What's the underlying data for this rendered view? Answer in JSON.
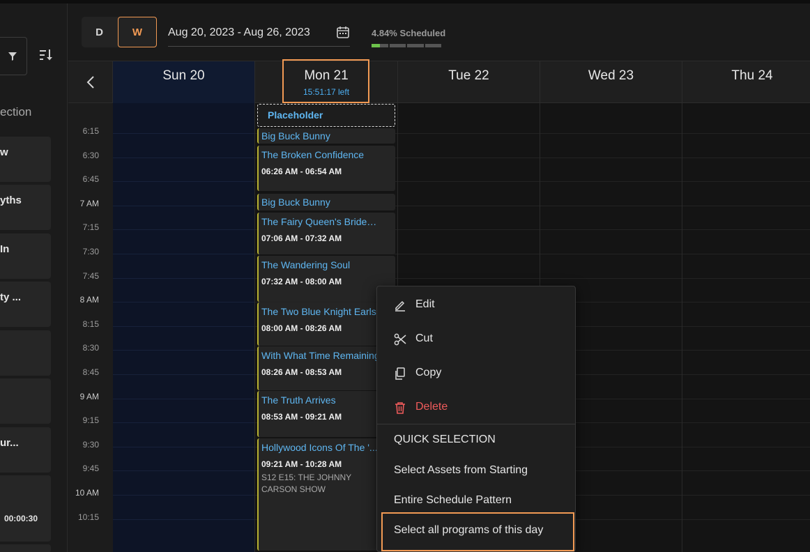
{
  "left_panel": {
    "section_label": "ection",
    "cards": [
      {
        "title": "w",
        "duration": ""
      },
      {
        "title": "yths",
        "duration": ""
      },
      {
        "title": "In",
        "duration": ""
      },
      {
        "title": "ty ...",
        "duration": ""
      },
      {
        "title": "",
        "duration": ""
      },
      {
        "title": "",
        "duration": ""
      },
      {
        "title": "ur...",
        "duration": ""
      },
      {
        "title": "",
        "duration": "00:00:30"
      }
    ]
  },
  "header": {
    "view_day": "D",
    "view_week": "W",
    "date_range": "Aug 20, 2023 - Aug 26, 2023",
    "scheduled_text": "4.84% Scheduled",
    "scheduled_fraction": 0.0484
  },
  "days": [
    {
      "label": "Sun 20",
      "remaining": ""
    },
    {
      "label": "Mon 21",
      "remaining": "15:51:17 left"
    },
    {
      "label": "Tue 22",
      "remaining": ""
    },
    {
      "label": "Wed 23",
      "remaining": ""
    },
    {
      "label": "Thu 24",
      "remaining": ""
    }
  ],
  "time_labels": [
    "6:15",
    "6:30",
    "6:45",
    "7 AM",
    "7:15",
    "7:30",
    "7:45",
    "8 AM",
    "8:15",
    "8:30",
    "8:45",
    "9 AM",
    "9:15",
    "9:30",
    "9:45",
    "10 AM",
    "10:15"
  ],
  "events": {
    "placeholder": "Placeholder",
    "items": [
      {
        "title": "Big Buck Bunny",
        "time": "",
        "subtitle": ""
      },
      {
        "title": "The Broken Confidence",
        "time": "06:26 AM - 06:54 AM",
        "subtitle": ""
      },
      {
        "title": "Big Buck Bunny",
        "time": "",
        "subtitle": ""
      },
      {
        "title": "The Fairy Queen's Bridegroom",
        "time": "07:06 AM - 07:32 AM",
        "subtitle": ""
      },
      {
        "title": "The Wandering Soul",
        "time": "07:32 AM - 08:00 AM",
        "subtitle": ""
      },
      {
        "title": "The Two Blue Knight Earls",
        "time": "08:00 AM - 08:26 AM",
        "subtitle": ""
      },
      {
        "title": "With What Time Remaining",
        "time": "08:26 AM - 08:53 AM",
        "subtitle": ""
      },
      {
        "title": "The Truth Arrives",
        "time": "08:53 AM - 09:21 AM",
        "subtitle": ""
      },
      {
        "title": "Hollywood Icons Of The '...",
        "time": "09:21 AM - 10:28 AM",
        "subtitle": "S12 E15: THE JOHNNY CARSON SHOW"
      }
    ]
  },
  "context_menu": {
    "edit": "Edit",
    "cut": "Cut",
    "copy": "Copy",
    "delete": "Delete",
    "quick_selection": "QUICK SELECTION",
    "select_assets": "Select Assets from Starting",
    "entire_pattern": "Entire Schedule Pattern",
    "select_day": "Select all programs of this day"
  },
  "colors": {
    "accent": "#f29a54",
    "link": "#5fb7f2",
    "danger": "#ef5b5b",
    "progress": "#6dc24b"
  }
}
